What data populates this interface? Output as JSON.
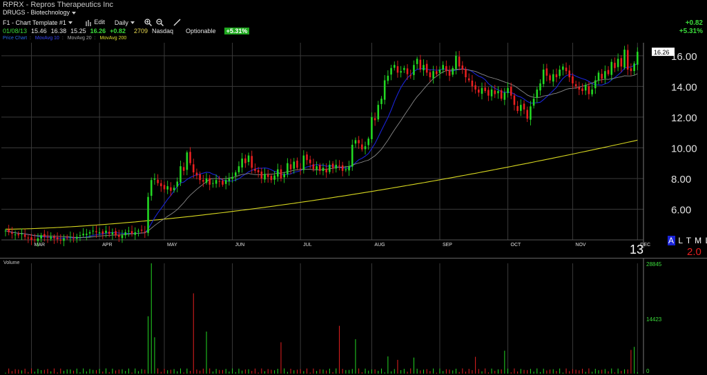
{
  "header": {
    "title": "RPRX - Repros Therapeutics Inc",
    "industry": "DRUGS - Biotechnology",
    "template": "F1 - Chart Template #1",
    "edit": "Edit",
    "interval": "Daily",
    "quote": {
      "date": "01/08/13",
      "open": "15.46",
      "high": "16.38",
      "low": "15.25",
      "close": "16.26",
      "change": "+0.82",
      "volume": "2709",
      "exchange": "Nasdaq",
      "optionable": "Optionable",
      "pct_badge": "+5.31%"
    },
    "change_right": "+0.82",
    "pct_right": "+5.31%"
  },
  "legend": {
    "price": "Price Chart",
    "ma10": "MovAvg 10",
    "ma20": "MovAvg 20",
    "ma200": "MovAvg 200",
    "sep": ":"
  },
  "colors": {
    "up": "#23d923",
    "down": "#e82020",
    "ma10": "#1a24d8",
    "ma20": "#8a8a8a",
    "ma200": "#d8d820",
    "grid": "#3a3a3a",
    "axis_text": "#e0e0e0",
    "vol_axis": "#3bdc3b"
  },
  "extras": {
    "atml": "A L T M L",
    "atml_first": "A",
    "num13": "13",
    "num20": "2.0",
    "last_price_tag": "16.26",
    "volume_label": "Volume"
  },
  "chart_data": [
    {
      "type": "candlestick",
      "title": "RPRX - Repros Therapeutics Inc",
      "xlabel": "",
      "ylabel": "",
      "x_tick_labels": [
        "MAR",
        "APR",
        "MAY",
        "JUN",
        "JUL",
        "AUG",
        "SEP",
        "OCT",
        "NOV",
        "DEC"
      ],
      "y_tick_labels": [
        "6.00",
        "8.00",
        "10.00",
        "12.00",
        "14.00",
        "16.00"
      ],
      "ylim": [
        4.0,
        16.4
      ],
      "grid": true,
      "last_price": 16.26,
      "close_series": [
        4.6,
        4.5,
        4.4,
        4.35,
        4.3,
        4.4,
        4.2,
        4.1,
        4.0,
        4.0,
        4.1,
        4.3,
        4.2,
        4.15,
        4.2,
        4.1,
        4.05,
        4.0,
        4.1,
        4.15,
        4.2,
        4.1,
        4.2,
        4.3,
        4.4,
        4.4,
        4.5,
        4.6,
        4.5,
        4.5,
        4.4,
        4.6,
        4.4,
        4.5,
        4.3,
        4.2,
        4.3,
        4.5,
        4.6,
        4.4,
        4.5,
        4.6,
        4.6,
        4.5,
        6.8,
        7.9,
        8.0,
        7.7,
        7.5,
        7.3,
        7.5,
        7.2,
        7.4,
        7.8,
        8.8,
        8.5,
        9.7,
        9.0,
        8.4,
        8.2,
        7.9,
        7.8,
        8.0,
        7.6,
        7.7,
        7.9,
        7.8,
        7.6,
        7.9,
        8.0,
        8.1,
        8.4,
        8.8,
        9.3,
        9.0,
        9.5,
        8.7,
        8.5,
        8.4,
        8.0,
        8.3,
        8.1,
        7.9,
        8.2,
        8.6,
        8.0,
        8.3,
        9.0,
        8.6,
        9.1,
        8.7,
        8.6,
        9.5,
        9.2,
        9.0,
        8.6,
        8.8,
        8.5,
        8.7,
        8.4,
        8.9,
        8.7,
        8.9,
        8.8,
        8.5,
        8.6,
        8.8,
        10.2,
        10.5,
        10.3,
        9.9,
        10.1,
        10.6,
        12.0,
        11.8,
        12.8,
        13.2,
        14.4,
        14.7,
        15.2,
        15.4,
        14.9,
        15.0,
        15.2,
        14.8,
        14.7,
        15.4,
        15.8,
        15.1,
        15.4,
        14.9,
        14.6,
        15.0,
        14.8,
        15.1,
        15.4,
        15.0,
        14.7,
        15.2,
        16.0,
        15.3,
        15.1,
        14.6,
        14.4,
        14.0,
        13.8,
        13.6,
        13.9,
        13.7,
        13.4,
        13.8,
        13.5,
        13.7,
        13.2,
        13.6,
        13.9,
        13.4,
        12.8,
        12.4,
        12.8,
        12.5,
        11.9,
        12.7,
        13.2,
        13.8,
        14.2,
        15.1,
        14.7,
        14.4,
        14.8,
        14.6,
        15.1,
        15.3,
        15.0,
        14.6,
        14.2,
        14.0,
        13.8,
        13.7,
        14.1,
        13.5,
        13.8,
        14.4,
        14.9,
        14.5,
        15.0,
        14.8,
        15.6,
        15.2,
        15.8,
        15.3,
        16.4,
        15.1,
        15.0,
        15.5,
        16.26
      ]
    },
    {
      "type": "bar",
      "title": "Volume",
      "y_tick_labels": [
        "28845",
        "14423",
        "0"
      ],
      "ylim": [
        0,
        28845
      ],
      "spike_values": [
        15000,
        28845,
        9500,
        21000,
        11000,
        8200,
        12500,
        9000,
        4500,
        3600,
        4200,
        4400,
        6000,
        6200,
        7000
      ],
      "base_level": 800
    }
  ]
}
